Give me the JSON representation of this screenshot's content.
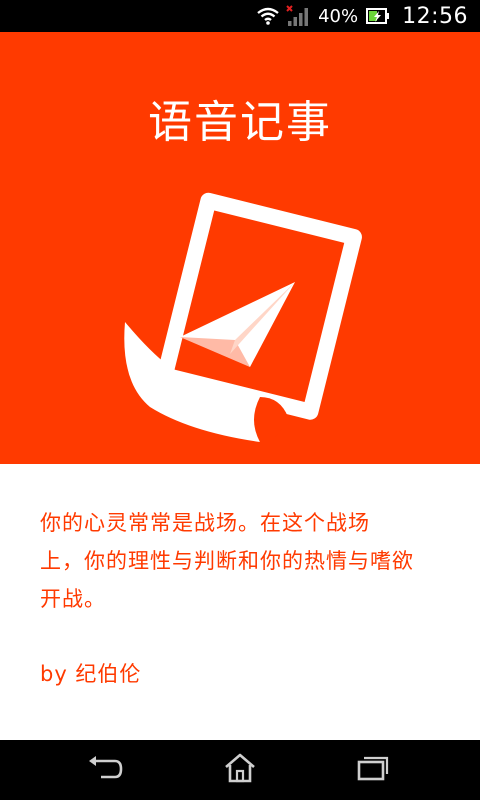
{
  "status_bar": {
    "battery_percent": "40%",
    "time": "12:56",
    "icons": [
      "wifi-icon",
      "signal-icon",
      "battery-charging-icon"
    ]
  },
  "hero": {
    "background_color": "#ff3a00",
    "title": "语音记事",
    "logo_icon": "paper-plane-document-icon"
  },
  "content": {
    "text_color": "#ff3a00",
    "quote_lines": [
      "你的心灵常常是战场。在这个战场",
      "上，你的理性与判断和你的热情与嗜欲",
      "开战。"
    ],
    "author": "by 纪伯伦"
  },
  "nav_bar": {
    "buttons": [
      "back-icon",
      "home-icon",
      "recent-apps-icon"
    ]
  }
}
